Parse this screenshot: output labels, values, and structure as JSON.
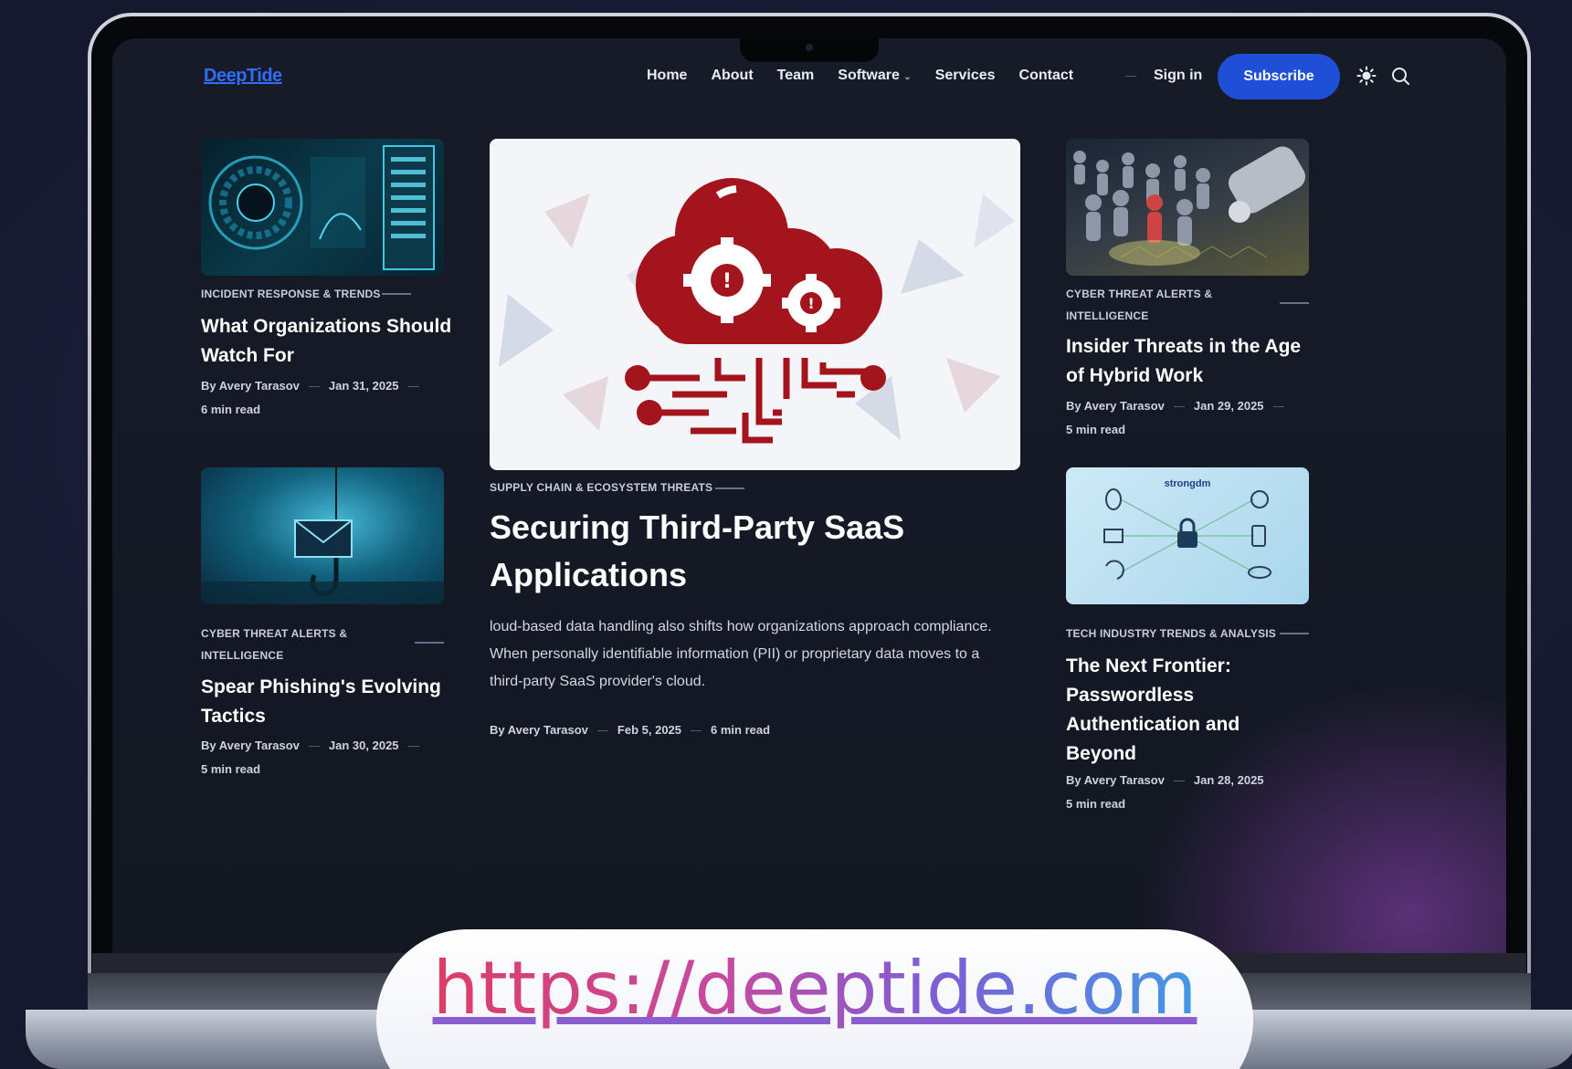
{
  "site": {
    "logo_text": "DeepTide"
  },
  "nav": {
    "items": [
      "Home",
      "About",
      "Team",
      "Software",
      "Services",
      "Contact"
    ],
    "software_has_dropdown": true,
    "signin_label": "Sign in",
    "subscribe_label": "Subscribe",
    "theme_icon": "sun-icon",
    "search_icon": "search-icon"
  },
  "colors": {
    "accent": "#1e4fd6",
    "background": "#151925",
    "hero_red": "#a3141c"
  },
  "articles": {
    "left": [
      {
        "category": "INCIDENT RESPONSE & TRENDS",
        "title": "What Organizations Should Watch For",
        "author": "By Avery Tarasov",
        "date": "Jan 31, 2025",
        "read": "6 min read",
        "image": "server-dashboard"
      },
      {
        "category": "CYBER THREAT ALERTS & INTELLIGENCE",
        "title": "Spear Phishing's Evolving Tactics",
        "author": "By Avery Tarasov",
        "date": "Jan 30, 2025",
        "read": "5 min read",
        "image": "envelope-on-hook"
      }
    ],
    "featured": {
      "category": "SUPPLY CHAIN & ECOSYSTEM THREATS",
      "title": "Securing Third-Party SaaS Applications",
      "excerpt": "loud-based data handling also shifts how organizations approach compliance. When personally identifiable information (PII) or proprietary data moves to a third-party SaaS provider's cloud.",
      "author": "By Avery Tarasov",
      "date": "Feb 5, 2025",
      "read": "6 min read",
      "image": "cloud-gears-circuit"
    },
    "right": [
      {
        "category": "CYBER THREAT ALERTS & INTELLIGENCE",
        "title": "Insider Threats in the Age of Hybrid Work",
        "author": "By Avery Tarasov",
        "date": "Jan 29, 2025",
        "read": "5 min read",
        "image": "crowd-spotlight"
      },
      {
        "category": "TECH INDUSTRY TRENDS & ANALYSIS",
        "title": "The Next Frontier: Passwordless Authentication and Beyond",
        "author": "By Avery Tarasov",
        "date": "Jan 28, 2025",
        "read": "5 min read",
        "image": "passwordless-icons",
        "image_label": "strongdm"
      }
    ]
  },
  "promo": {
    "url": "https://deeptide.com"
  }
}
